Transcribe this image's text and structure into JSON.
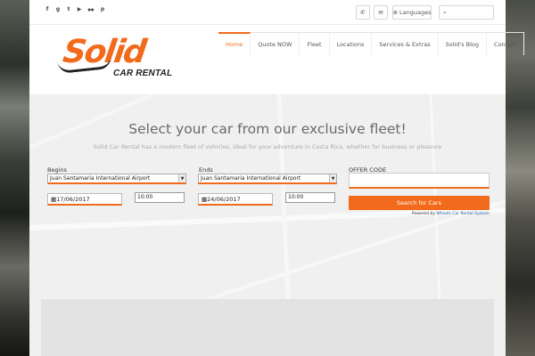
{
  "social": {
    "icons": [
      "facebook-icon",
      "google-plus-icon",
      "twitter-icon",
      "youtube-icon",
      "flickr-icon",
      "pinterest-icon"
    ],
    "glyphs": [
      "f",
      "g",
      "t",
      "▶",
      "●●",
      "p"
    ]
  },
  "topbar": {
    "phone_glyph": "✆",
    "mail_glyph": "✉",
    "languages_label": "Languages",
    "languages_glyph": "⊕",
    "search_glyph": "⌕"
  },
  "logo": {
    "word": "Solid",
    "subtitle": "CAR RENTAL"
  },
  "nav": {
    "items": [
      "Home",
      "Quote NOW",
      "Fleet",
      "Locations",
      "Services & Extras",
      "Solid's Blog",
      "Contact"
    ]
  },
  "hero": {
    "title": "Select your car from our exclusive fleet!",
    "subtitle": "Solid Car Rental has a modern fleet of vehicles, ideal for your adventure in Costa Rica, whether for business or pleasure"
  },
  "form": {
    "begins_label": "Begins",
    "ends_label": "Ends",
    "offer_label": "OFFER CODE",
    "pickup_location": "Juan Santamaria International Airport",
    "dropoff_location": "Juan Santamaria International Airport",
    "pickup_date": "17/06/2017",
    "dropoff_date": "24/06/2017",
    "pickup_time": "10:00",
    "dropoff_time": "10:00",
    "search_button": "Search for Cars",
    "powered_prefix": "Powered by",
    "powered_link": "Wheels Car Rental System"
  },
  "colors": {
    "accent": "#f26a1b"
  }
}
